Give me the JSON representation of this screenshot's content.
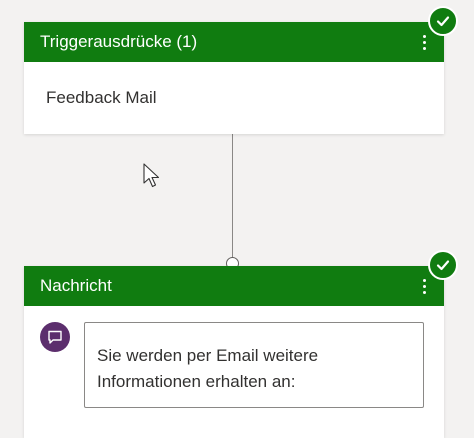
{
  "colors": {
    "header_green": "#107c10",
    "message_icon_purple": "#5c2e6d",
    "canvas_background": "#f3f2f1"
  },
  "trigger_node": {
    "title": "Triggerausdrücke (1)",
    "phrase": "Feedback Mail",
    "status_icon": "checkmark-circle-icon",
    "menu_icon": "more-vertical-icon"
  },
  "message_node": {
    "title": "Nachricht",
    "message_text": "Sie werden per Email weitere Informationen erhalten an:",
    "status_icon": "checkmark-circle-icon",
    "menu_icon": "more-vertical-icon",
    "message_icon": "chat-bubble-icon"
  }
}
